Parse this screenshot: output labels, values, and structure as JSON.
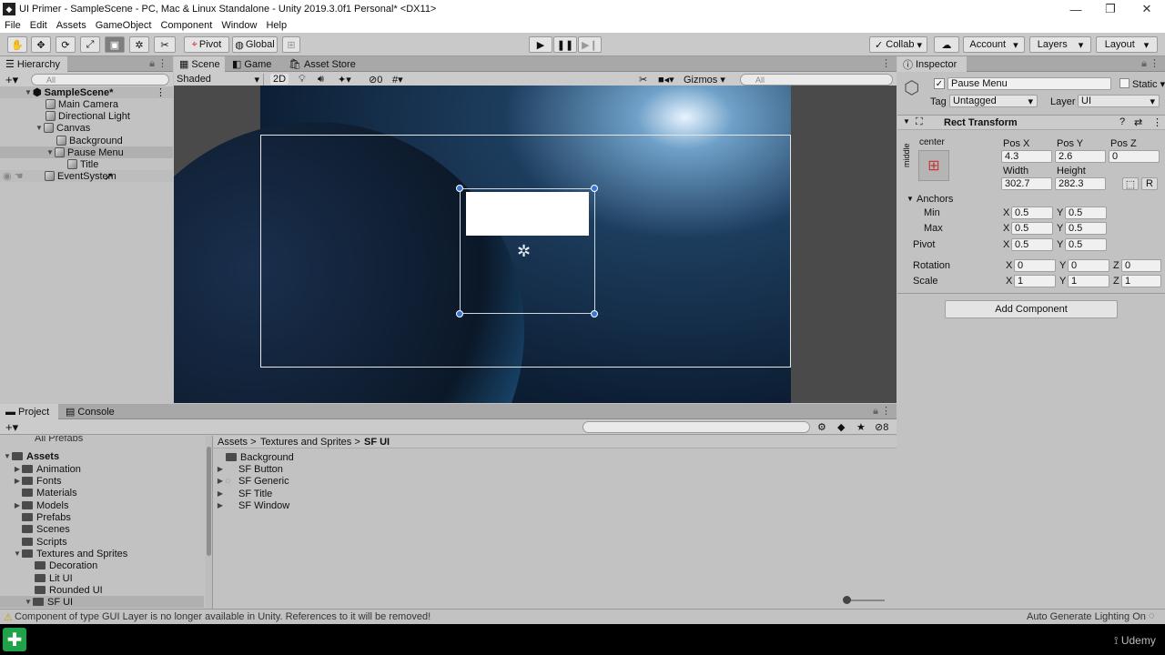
{
  "window": {
    "title": "UI Primer - SampleScene - PC, Mac & Linux Standalone - Unity 2019.3.0f1 Personal* <DX11>"
  },
  "menu": [
    "File",
    "Edit",
    "Assets",
    "GameObject",
    "Component",
    "Window",
    "Help"
  ],
  "toolbar": {
    "pivot": "Pivot",
    "global": "Global",
    "collab": "Collab",
    "account": "Account",
    "layers": "Layers",
    "layout": "Layout"
  },
  "hierarchy": {
    "tab": "Hierarchy",
    "search_placeholder": "All",
    "scene": "SampleScene*",
    "items": [
      "Main Camera",
      "Directional Light",
      "Canvas",
      "Background",
      "Pause Menu",
      "Title",
      "EventSystem"
    ]
  },
  "scene_view": {
    "tabs": [
      "Scene",
      "Game",
      "Asset Store"
    ],
    "shading": "Shaded",
    "mode_2d": "2D",
    "hidden_count": "0",
    "gizmos": "Gizmos",
    "search_placeholder": "All"
  },
  "inspector": {
    "tab": "Inspector",
    "object_name": "Pause Menu",
    "static_label": "Static",
    "tag_label": "Tag",
    "tag": "Untagged",
    "layer_label": "Layer",
    "layer": "UI",
    "component": "Rect Transform",
    "anchor_h": "center",
    "anchor_v": "middle",
    "pos_x_label": "Pos X",
    "pos_y_label": "Pos Y",
    "pos_z_label": "Pos Z",
    "pos_x": "4.3",
    "pos_y": "2.6",
    "pos_z": "0",
    "width_label": "Width",
    "height_label": "Height",
    "width": "302.7",
    "height": "282.3",
    "r_btn": "R",
    "anchors_label": "Anchors",
    "min_label": "Min",
    "max_label": "Max",
    "pivot_label": "Pivot",
    "x": "X",
    "y": "Y",
    "z": "Z",
    "min_x": "0.5",
    "min_y": "0.5",
    "max_x": "0.5",
    "max_y": "0.5",
    "pivot_x": "0.5",
    "pivot_y": "0.5",
    "rotation_label": "Rotation",
    "scale_label": "Scale",
    "rot_x": "0",
    "rot_y": "0",
    "rot_z": "0",
    "scale_x": "1",
    "scale_y": "1",
    "scale_z": "1",
    "add_component": "Add Component"
  },
  "project": {
    "tabs": [
      "Project",
      "Console"
    ],
    "breadcrumb": [
      "Assets",
      "Textures and Sprites",
      "SF UI"
    ],
    "cut_item": "All Prefabs",
    "root": "Assets",
    "tree": [
      "Animation",
      "Fonts",
      "Materials",
      "Models",
      "Prefabs",
      "Scenes",
      "Scripts",
      "Textures and Sprites",
      "Decoration",
      "Lit UI",
      "Rounded UI",
      "SF UI"
    ],
    "assets": [
      "Background",
      "SF Button",
      "SF Generic",
      "SF Title",
      "SF Window"
    ],
    "count": "8"
  },
  "status": {
    "message": "Component of type GUI Layer is no longer available in Unity. References to it will be removed!",
    "right": "Auto Generate Lighting On"
  },
  "taskbar": {
    "brand": "Udemy"
  }
}
